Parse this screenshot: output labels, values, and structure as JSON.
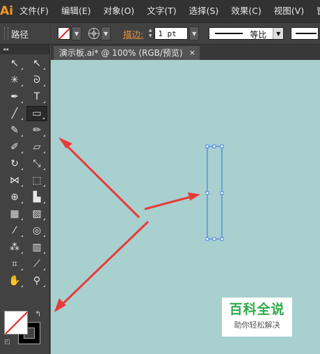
{
  "app": {
    "logo": "Ai"
  },
  "menu": [
    "文件(F)",
    "编辑(E)",
    "对象(O)",
    "文字(T)",
    "选择(S)",
    "效果(C)",
    "视图(V)",
    "窗"
  ],
  "control_bar": {
    "object_type": "路径",
    "stroke_label": "描边:",
    "stroke_weight": "1 pt",
    "stroke_profile": "等比"
  },
  "document_tab": {
    "title": "演示板.ai* @ 100% (RGB/预览)",
    "close": "×"
  },
  "toolbar": {
    "collapse": "◂◂",
    "tools": [
      {
        "name": "selection-tool",
        "glyph": "↖"
      },
      {
        "name": "direct-selection-tool",
        "glyph": "↖"
      },
      {
        "name": "magic-wand-tool",
        "glyph": "✳"
      },
      {
        "name": "lasso-tool",
        "glyph": "ᘐ"
      },
      {
        "name": "pen-tool",
        "glyph": "✒"
      },
      {
        "name": "type-tool",
        "glyph": "T"
      },
      {
        "name": "line-segment-tool",
        "glyph": "╱"
      },
      {
        "name": "rectangle-tool",
        "glyph": "▭"
      },
      {
        "name": "paintbrush-tool",
        "glyph": "✎"
      },
      {
        "name": "pencil-tool",
        "glyph": "✏"
      },
      {
        "name": "blob-brush-tool",
        "glyph": "✐"
      },
      {
        "name": "eraser-tool",
        "glyph": "▱"
      },
      {
        "name": "rotate-tool",
        "glyph": "↻"
      },
      {
        "name": "scale-tool",
        "glyph": "⤡"
      },
      {
        "name": "width-tool",
        "glyph": "⋈"
      },
      {
        "name": "free-transform-tool",
        "glyph": "⬚"
      },
      {
        "name": "shape-builder-tool",
        "glyph": "⊕"
      },
      {
        "name": "graph-tool",
        "glyph": "▙"
      },
      {
        "name": "mesh-tool",
        "glyph": "▦"
      },
      {
        "name": "gradient-tool",
        "glyph": "▨"
      },
      {
        "name": "eyedropper-tool",
        "glyph": "⁄"
      },
      {
        "name": "blend-tool",
        "glyph": "◎"
      },
      {
        "name": "symbol-sprayer-tool",
        "glyph": "⁂"
      },
      {
        "name": "column-graph-tool",
        "glyph": "▥"
      },
      {
        "name": "artboard-tool",
        "glyph": "⌗"
      },
      {
        "name": "slice-tool",
        "glyph": "⟋"
      },
      {
        "name": "hand-tool",
        "glyph": "✋"
      },
      {
        "name": "zoom-tool",
        "glyph": "⚲"
      }
    ],
    "active_tool": "rectangle-tool"
  },
  "watermark": {
    "title": "百科全说",
    "subtitle": "助你轻松解决"
  },
  "colors": {
    "canvas": "#a7d0cf",
    "arrow": "#e83a3a",
    "selection": "#4a7fe0",
    "accent": "#f79a1f"
  }
}
